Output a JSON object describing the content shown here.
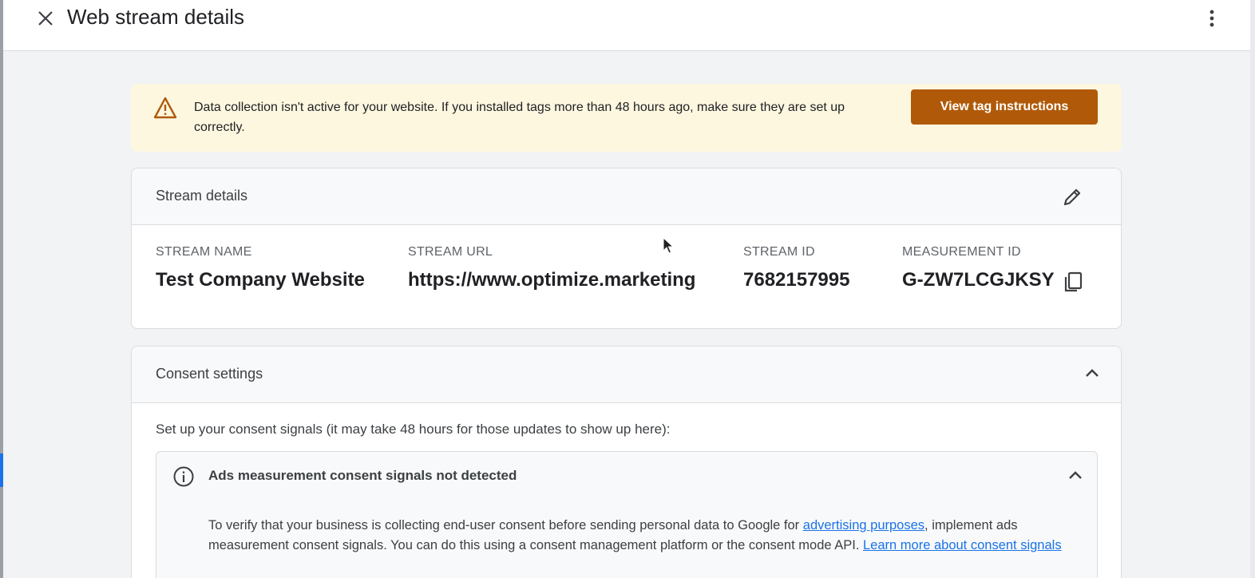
{
  "header": {
    "title": "Web stream details"
  },
  "alert": {
    "message": "Data collection isn't active for your website. If you installed tags more than 48 hours ago, make sure they are set up correctly.",
    "button_label": "View tag instructions"
  },
  "stream_details": {
    "title": "Stream details",
    "fields": [
      {
        "label": "STREAM NAME",
        "value": "Test Company Website"
      },
      {
        "label": "STREAM URL",
        "value": "https://www.optimize.marketing"
      },
      {
        "label": "STREAM ID",
        "value": "7682157995"
      },
      {
        "label": "MEASUREMENT ID",
        "value": "G-ZW7LCGJKSY"
      }
    ]
  },
  "consent": {
    "title": "Consent settings",
    "intro": "Set up your consent signals (it may take 48 hours for those updates to show up here):",
    "panel": {
      "title": "Ads measurement consent signals not detected",
      "body_part1": "To verify that your business is collecting end-user consent before sending personal data to Google for ",
      "link1": "advertising purposes",
      "body_part2": ", implement ads measurement consent signals. You can do this using a consent management platform or the consent mode API. ",
      "link2": "Learn more about consent signals"
    }
  },
  "colors": {
    "alert_bg": "#fef7e0",
    "alert_button": "#b05a09",
    "link": "#1a73e8"
  },
  "icons": [
    "close-icon",
    "more-vert-icon",
    "warning-icon",
    "edit-icon",
    "copy-icon",
    "chevron-up-icon",
    "info-icon",
    "mouse-cursor"
  ]
}
